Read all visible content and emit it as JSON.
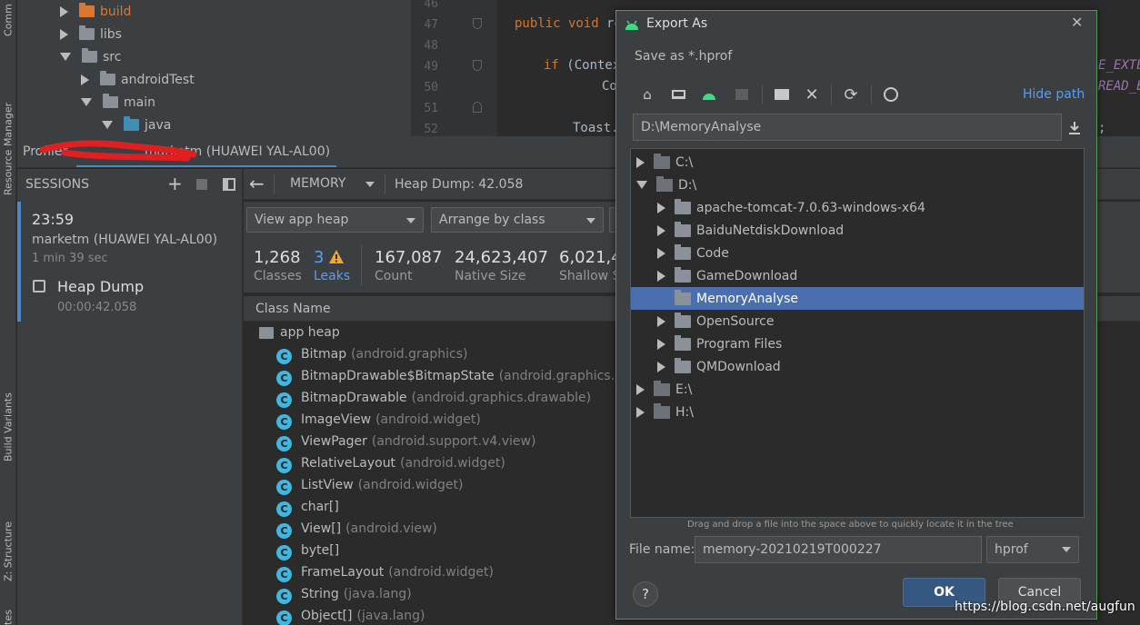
{
  "tool_strip": {
    "top_label": "Comm",
    "resource_manager": "Resource Manager",
    "build_variants": "Build Variants",
    "structure": "Z: Structure",
    "bottom_label": "tes"
  },
  "project_tree": [
    {
      "label": "build",
      "expanded": false,
      "color": "orange"
    },
    {
      "label": "libs",
      "expanded": false,
      "color": "grey"
    },
    {
      "label": "src",
      "expanded": true,
      "color": "grey"
    },
    {
      "label": "androidTest",
      "expanded": false,
      "color": "grey"
    },
    {
      "label": "main",
      "expanded": true,
      "color": "grey"
    },
    {
      "label": "java",
      "expanded": true,
      "color": "blue"
    }
  ],
  "editor": {
    "line_numbers": [
      "46",
      "47",
      "48",
      "49",
      "50",
      "51",
      "52"
    ],
    "line47": {
      "kw": "public void",
      "rest": " re"
    },
    "line49": {
      "kw": "if",
      "rest": " (Contex"
    },
    "line50": "Co",
    "line52": "Toast.",
    "right_frag1": "E_EXTE",
    "right_frag2": "READ_E",
    "right_frag3": ";"
  },
  "profiler": {
    "tab_label": "Profiler",
    "device_label": "marketm (HUAWEI YAL-AL00)",
    "sessions_label": "SESSIONS",
    "session": {
      "time": "23:59",
      "device": "marketm (HUAWEI YAL-AL00)",
      "duration": "1 min 39 sec",
      "item_label": "Heap Dump",
      "item_time": "00:00:42.058"
    },
    "memory_label": "MEMORY",
    "heap_dump_label": "Heap Dump: 42.058",
    "view_combo": "View app heap",
    "arrange_combo": "Arrange by class",
    "stats": [
      {
        "value": "1,268",
        "label": "Classes"
      },
      {
        "value": "3",
        "label": "Leaks",
        "link": true
      },
      {
        "value": "167,087",
        "label": "Count"
      },
      {
        "value": "24,623,407",
        "label": "Native Size"
      },
      {
        "value": "6,021,4",
        "label": "Shallow S"
      }
    ],
    "column_header": "Class Name",
    "root_label": "app heap",
    "classes": [
      {
        "name": "Bitmap",
        "pkg": "(android.graphics)"
      },
      {
        "name": "BitmapDrawable$BitmapState",
        "pkg": "(android.graphics.dra"
      },
      {
        "name": "BitmapDrawable",
        "pkg": "(android.graphics.drawable)"
      },
      {
        "name": "ImageView",
        "pkg": "(android.widget)"
      },
      {
        "name": "ViewPager",
        "pkg": "(android.support.v4.view)"
      },
      {
        "name": "RelativeLayout",
        "pkg": "(android.widget)"
      },
      {
        "name": "ListView",
        "pkg": "(android.widget)"
      },
      {
        "name": "char[]",
        "pkg": ""
      },
      {
        "name": "View[]",
        "pkg": "(android.view)"
      },
      {
        "name": "byte[]",
        "pkg": ""
      },
      {
        "name": "FrameLayout",
        "pkg": "(android.widget)"
      },
      {
        "name": "String",
        "pkg": "(java.lang)"
      },
      {
        "name": "Object[]",
        "pkg": "(java.lang)"
      }
    ]
  },
  "dialog": {
    "title": "Export As",
    "subtitle": "Save as *.hprof",
    "hide_path": "Hide path",
    "path_value": "D:\\MemoryAnalyse",
    "tree": [
      {
        "label": "C:\\",
        "level": 0,
        "expanded": false,
        "drive": true
      },
      {
        "label": "D:\\",
        "level": 0,
        "expanded": true,
        "drive": true
      },
      {
        "label": "apache-tomcat-7.0.63-windows-x64",
        "level": 1,
        "expanded": false
      },
      {
        "label": "BaiduNetdiskDownload",
        "level": 1,
        "expanded": false
      },
      {
        "label": "Code",
        "level": 1,
        "expanded": false
      },
      {
        "label": "GameDownload",
        "level": 1,
        "expanded": false
      },
      {
        "label": "MemoryAnalyse",
        "level": 1,
        "selected": true,
        "leaf": true
      },
      {
        "label": "OpenSource",
        "level": 1,
        "expanded": false
      },
      {
        "label": "Program Files",
        "level": 1,
        "expanded": false
      },
      {
        "label": "QMDownload",
        "level": 1,
        "expanded": false
      },
      {
        "label": "E:\\",
        "level": 0,
        "expanded": false,
        "drive": true
      },
      {
        "label": "H:\\",
        "level": 0,
        "expanded": false,
        "drive": true
      }
    ],
    "hint": "Drag and drop a file into the space above to quickly locate it in the tree",
    "file_name_label": "File name:",
    "file_name_value": "memory-20210219T000227",
    "file_type": "hprof",
    "ok_label": "OK",
    "cancel_label": "Cancel",
    "help_label": "?"
  },
  "watermark": "https://blog.csdn.net/augfun",
  "colors": {
    "accent": "#4b6eaf",
    "link": "#589df6",
    "android_green": "#3ddc84",
    "warning": "#f0a732",
    "class_icon": "#40b6e0"
  }
}
